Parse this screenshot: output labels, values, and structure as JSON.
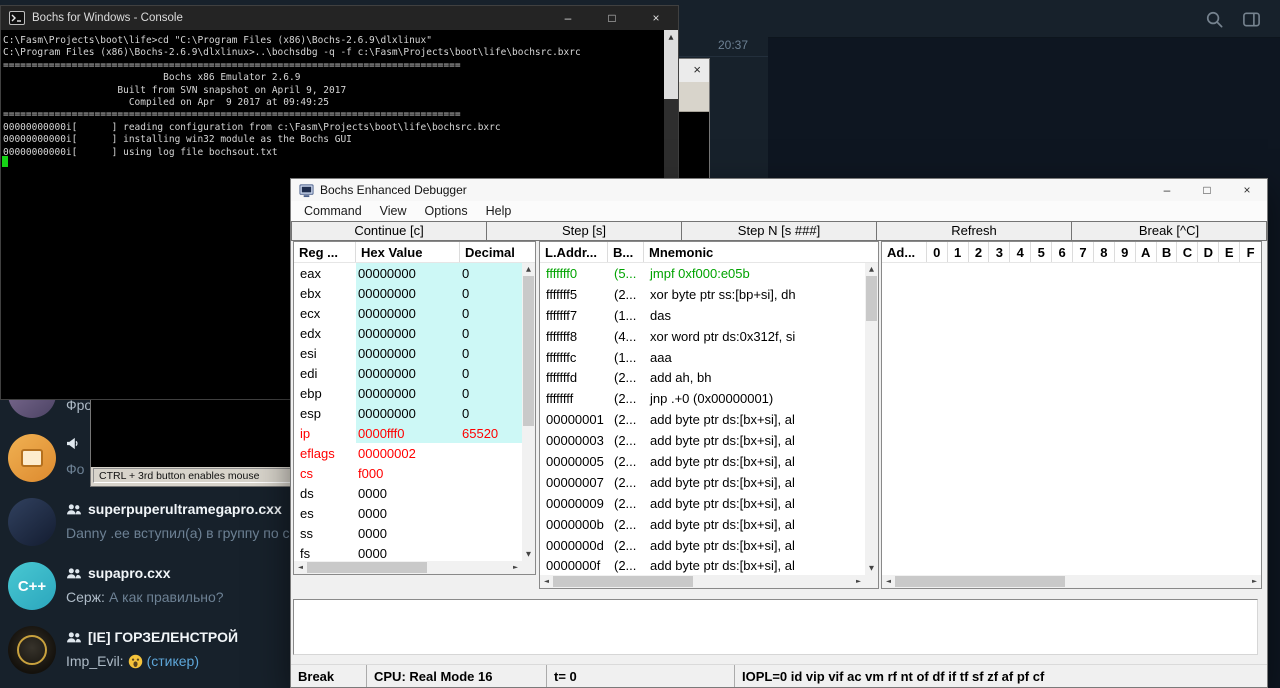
{
  "glyphs": {
    "minimize": "–",
    "maximize": "□",
    "close": "×",
    "up": "▲",
    "down": "▼",
    "left": "◄",
    "right": "►"
  },
  "telegram": {
    "time_label": "20:37",
    "cpp_avatar_label": "C++",
    "chats": [
      {
        "sender": "Фро"
      },
      {
        "message": "Фо"
      },
      {
        "name": "superpuperultramegapro.cxx",
        "message": "Danny .ee вступил(а) в группу по сс"
      },
      {
        "name": "supapro.cxx",
        "sender": "Серж:",
        "message": "А как правильно?",
        "avatar_label": "C++"
      },
      {
        "name": "[IE] ГОРЗЕЛЕНСТРОЙ",
        "sender": "Imp_Evil:",
        "emoji": "😱",
        "message": "(стикер)"
      }
    ]
  },
  "console": {
    "title": "Bochs for Windows - Console",
    "lines": [
      "C:\\Fasm\\Projects\\boot\\life>cd \"C:\\Program Files (x86)\\Bochs-2.6.9\\dlxlinux\"",
      "",
      "C:\\Program Files (x86)\\Bochs-2.6.9\\dlxlinux>..\\bochsdbg -q -f c:\\Fasm\\Projects\\boot\\life\\bochsrc.bxrc",
      "================================================================================",
      "                            Bochs x86 Emulator 2.6.9",
      "                    Built from SVN snapshot on April 9, 2017",
      "                      Compiled on Apr  9 2017 at 09:49:25",
      "================================================================================",
      "00000000000i[      ] reading configuration from c:\\Fasm\\Projects\\boot\\life\\bochsrc.bxrc",
      "00000000000i[      ] installing win32 module as the Bochs GUI",
      "00000000000i[      ] using log file bochsout.txt"
    ]
  },
  "vga_window": {
    "status_text": "CTRL + 3rd button enables mouse"
  },
  "debugger": {
    "title": "Bochs Enhanced Debugger",
    "menu": [
      "Command",
      "View",
      "Options",
      "Help"
    ],
    "toolbar": [
      "Continue [c]",
      "Step [s]",
      "Step N [s ###]",
      "Refresh",
      "Break [^C]"
    ],
    "colors": {
      "band": "#cdf8f6",
      "changed": "#ff0000",
      "current": "#00a300"
    },
    "registers": {
      "headers": [
        "Reg ...",
        "Hex Value",
        "Decimal"
      ],
      "rows": [
        {
          "name": "eax",
          "hex": "00000000",
          "dec": "0",
          "band": true,
          "changed": false
        },
        {
          "name": "ebx",
          "hex": "00000000",
          "dec": "0",
          "band": true,
          "changed": false
        },
        {
          "name": "ecx",
          "hex": "00000000",
          "dec": "0",
          "band": true,
          "changed": false
        },
        {
          "name": "edx",
          "hex": "00000000",
          "dec": "0",
          "band": true,
          "changed": false
        },
        {
          "name": "esi",
          "hex": "00000000",
          "dec": "0",
          "band": true,
          "changed": false
        },
        {
          "name": "edi",
          "hex": "00000000",
          "dec": "0",
          "band": true,
          "changed": false
        },
        {
          "name": "ebp",
          "hex": "00000000",
          "dec": "0",
          "band": true,
          "changed": false
        },
        {
          "name": "esp",
          "hex": "00000000",
          "dec": "0",
          "band": true,
          "changed": false
        },
        {
          "name": "ip",
          "hex": "0000fff0",
          "dec": "65520",
          "band": true,
          "changed": true
        },
        {
          "name": "eflags",
          "hex": "00000002",
          "dec": "",
          "band": false,
          "changed": true
        },
        {
          "name": "cs",
          "hex": "f000",
          "dec": "",
          "band": false,
          "changed": true
        },
        {
          "name": "ds",
          "hex": "0000",
          "dec": "",
          "band": false,
          "changed": false
        },
        {
          "name": "es",
          "hex": "0000",
          "dec": "",
          "band": false,
          "changed": false
        },
        {
          "name": "ss",
          "hex": "0000",
          "dec": "",
          "band": false,
          "changed": false
        },
        {
          "name": "fs",
          "hex": "0000",
          "dec": "",
          "band": false,
          "changed": false
        }
      ]
    },
    "disasm": {
      "headers": [
        "L.Addr...",
        "B...",
        "Mnemonic"
      ],
      "rows": [
        {
          "addr": "fffffff0",
          "b": "(5...",
          "mn": "jmpf 0xf000:e05b",
          "current": true
        },
        {
          "addr": "fffffff5",
          "b": "(2...",
          "mn": "xor byte ptr ss:[bp+si], dh",
          "current": false
        },
        {
          "addr": "fffffff7",
          "b": "(1...",
          "mn": "das",
          "current": false
        },
        {
          "addr": "fffffff8",
          "b": "(4...",
          "mn": "xor word ptr ds:0x312f, si",
          "current": false
        },
        {
          "addr": "fffffffc",
          "b": "(1...",
          "mn": "aaa",
          "current": false
        },
        {
          "addr": "fffffffd",
          "b": "(2...",
          "mn": "add ah, bh",
          "current": false
        },
        {
          "addr": "ffffffff",
          "b": "(2...",
          "mn": "jnp .+0 (0x00000001)",
          "current": false
        },
        {
          "addr": "00000001",
          "b": "(2...",
          "mn": "add byte ptr ds:[bx+si], al",
          "current": false
        },
        {
          "addr": "00000003",
          "b": "(2...",
          "mn": "add byte ptr ds:[bx+si], al",
          "current": false
        },
        {
          "addr": "00000005",
          "b": "(2...",
          "mn": "add byte ptr ds:[bx+si], al",
          "current": false
        },
        {
          "addr": "00000007",
          "b": "(2...",
          "mn": "add byte ptr ds:[bx+si], al",
          "current": false
        },
        {
          "addr": "00000009",
          "b": "(2...",
          "mn": "add byte ptr ds:[bx+si], al",
          "current": false
        },
        {
          "addr": "0000000b",
          "b": "(2...",
          "mn": "add byte ptr ds:[bx+si], al",
          "current": false
        },
        {
          "addr": "0000000d",
          "b": "(2...",
          "mn": "add byte ptr ds:[bx+si], al",
          "current": false
        },
        {
          "addr": "0000000f",
          "b": "(2...",
          "mn": "add byte ptr ds:[bx+si], al",
          "current": false
        }
      ]
    },
    "memory": {
      "headers": [
        "Ad...",
        "0",
        "1",
        "2",
        "3",
        "4",
        "5",
        "6",
        "7",
        "8",
        "9",
        "A",
        "B",
        "C",
        "D",
        "E",
        "F"
      ]
    },
    "status": {
      "mode": "Break",
      "cpu": "CPU: Real Mode 16",
      "time": "t= 0",
      "flags": "IOPL=0 id vip vif ac vm rf nt of df if tf sf zf af pf cf"
    }
  }
}
